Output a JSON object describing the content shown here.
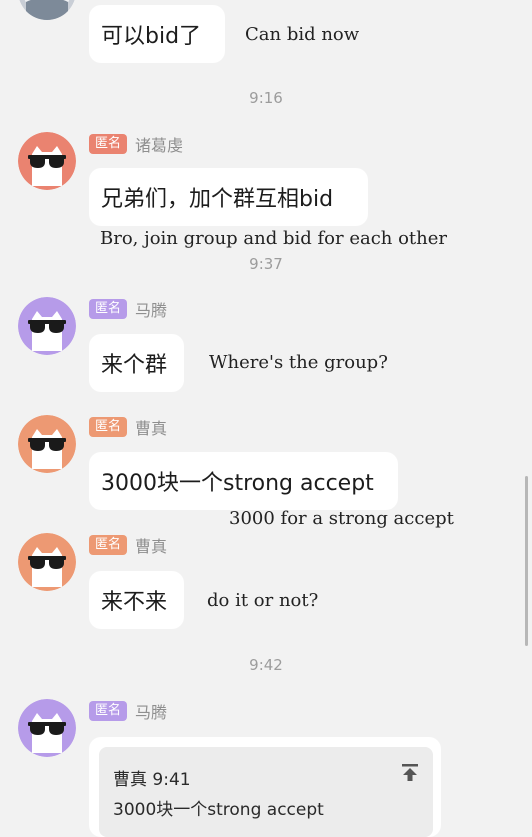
{
  "messages": [
    {
      "id": "m0",
      "avatar_color": "#7d8a99",
      "bubble_text": "可以bid了",
      "translation": "Can bid now"
    },
    {
      "id": "m1",
      "badge": "匿名",
      "badge_color": "#ea8370",
      "name": "诸葛虔",
      "avatar_color": "#ea8370",
      "bubble_text": "兄弟们，加个群互相bid",
      "translation": "Bro, join group and bid for each other"
    },
    {
      "id": "m2",
      "badge": "匿名",
      "badge_color": "#b69be9",
      "name": "马腾",
      "avatar_color": "#b69be9",
      "bubble_text": "来个群",
      "translation": "Where's the group?"
    },
    {
      "id": "m3",
      "badge": "匿名",
      "badge_color": "#ed9973",
      "name": "曹真",
      "avatar_color": "#ed9973",
      "bubble_text": "3000块一个strong accept",
      "translation": "3000 for a strong accept"
    },
    {
      "id": "m4",
      "badge": "匿名",
      "badge_color": "#ed9973",
      "name": "曹真",
      "avatar_color": "#ed9973",
      "bubble_text": "来不来",
      "translation": "do it or not?"
    },
    {
      "id": "m5",
      "badge": "匿名",
      "badge_color": "#b69be9",
      "name": "马腾",
      "avatar_color": "#b69be9",
      "quote": {
        "header": "曹真 9:41",
        "body": "3000块一个strong accept",
        "icon": "pin-top-icon"
      }
    }
  ],
  "timestamps": [
    "9:16",
    "9:37",
    "9:42"
  ]
}
